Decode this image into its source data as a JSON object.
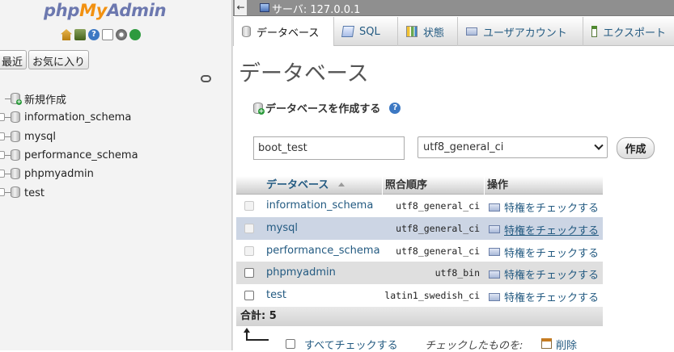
{
  "logo": {
    "part1": "php",
    "part2": "My",
    "part3": "Admin"
  },
  "nav": {
    "tabs": [
      "最近",
      "お気に入り"
    ],
    "tree": [
      {
        "label": "新規作成",
        "type": "new"
      },
      {
        "label": "information_schema",
        "type": "db"
      },
      {
        "label": "mysql",
        "type": "db"
      },
      {
        "label": "performance_schema",
        "type": "db"
      },
      {
        "label": "phpmyadmin",
        "type": "db"
      },
      {
        "label": "test",
        "type": "db"
      }
    ]
  },
  "topbar": {
    "back": "←",
    "server_label": "サーバ: 127.0.0.1"
  },
  "tabs": [
    {
      "label": "データベース",
      "icon": "database-icon",
      "active": true
    },
    {
      "label": "SQL",
      "icon": "sql-icon",
      "active": false
    },
    {
      "label": "状態",
      "icon": "status-icon",
      "active": false
    },
    {
      "label": "ユーザアカウント",
      "icon": "users-icon",
      "active": false
    },
    {
      "label": "エクスポート",
      "icon": "export-icon",
      "active": false
    }
  ],
  "page_title": "データベース",
  "create": {
    "heading": "データベースを作成する",
    "db_name_value": "boot_test",
    "collation_value": "utf8_general_ci",
    "button": "作成"
  },
  "table": {
    "headers": {
      "database": "データベース",
      "collation": "照合順序",
      "action": "操作"
    },
    "rows": [
      {
        "name": "information_schema",
        "collation": "utf8_general_ci",
        "action": "特権をチェックする",
        "checkbox_enabled": false
      },
      {
        "name": "mysql",
        "collation": "utf8_general_ci",
        "action": "特権をチェックする",
        "checkbox_enabled": false,
        "highlighted": true
      },
      {
        "name": "performance_schema",
        "collation": "utf8_general_ci",
        "action": "特権をチェックする",
        "checkbox_enabled": false
      },
      {
        "name": "phpmyadmin",
        "collation": "utf8_bin",
        "action": "特権をチェックする",
        "checkbox_enabled": true
      },
      {
        "name": "test",
        "collation": "latin1_swedish_ci",
        "action": "特権をチェックする",
        "checkbox_enabled": true
      }
    ],
    "total": "合計: 5"
  },
  "bulk": {
    "check_all": "すべてチェックする",
    "with_selected": "チェックしたものを:",
    "drop": "削除"
  },
  "colors": {
    "link": "#235a81",
    "logo_blue": "#6c78af",
    "logo_orange": "#f29111",
    "topbar": "#8f8f8f",
    "row_highlight": "#ccd5e4"
  }
}
